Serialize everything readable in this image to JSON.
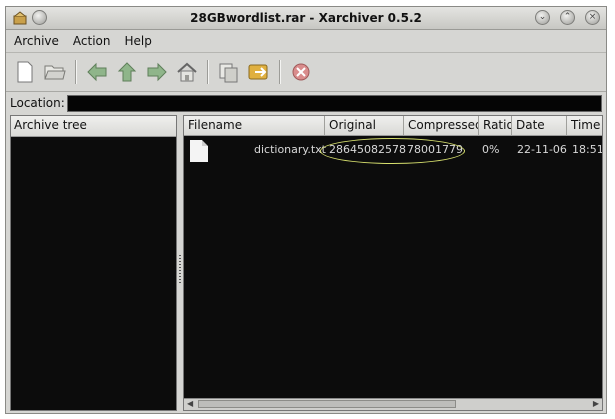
{
  "window": {
    "title": "28GBwordlist.rar - Xarchiver 0.5.2"
  },
  "menu": {
    "archive": "Archive",
    "action": "Action",
    "help": "Help"
  },
  "toolbar": {
    "icons": [
      "new-icon",
      "open-icon",
      "back-icon",
      "up-icon",
      "forward-icon",
      "home-icon",
      "extract-icon",
      "add-icon",
      "stop-icon"
    ]
  },
  "location": {
    "label": "Location:",
    "value": ""
  },
  "archive_tree": {
    "header": "Archive tree"
  },
  "columns": [
    "Filename",
    "Original",
    "Compressed",
    "Ratio",
    "Date",
    "Time"
  ],
  "files": [
    {
      "name": "dictionary.txt",
      "original": "28645082578",
      "compressed": "78001779",
      "ratio": "0%",
      "date": "22-11-06",
      "time": "18:51"
    }
  ],
  "colors": {
    "annotation_circle": "#d7e06e",
    "pane_bg": "#0c0c0c"
  }
}
